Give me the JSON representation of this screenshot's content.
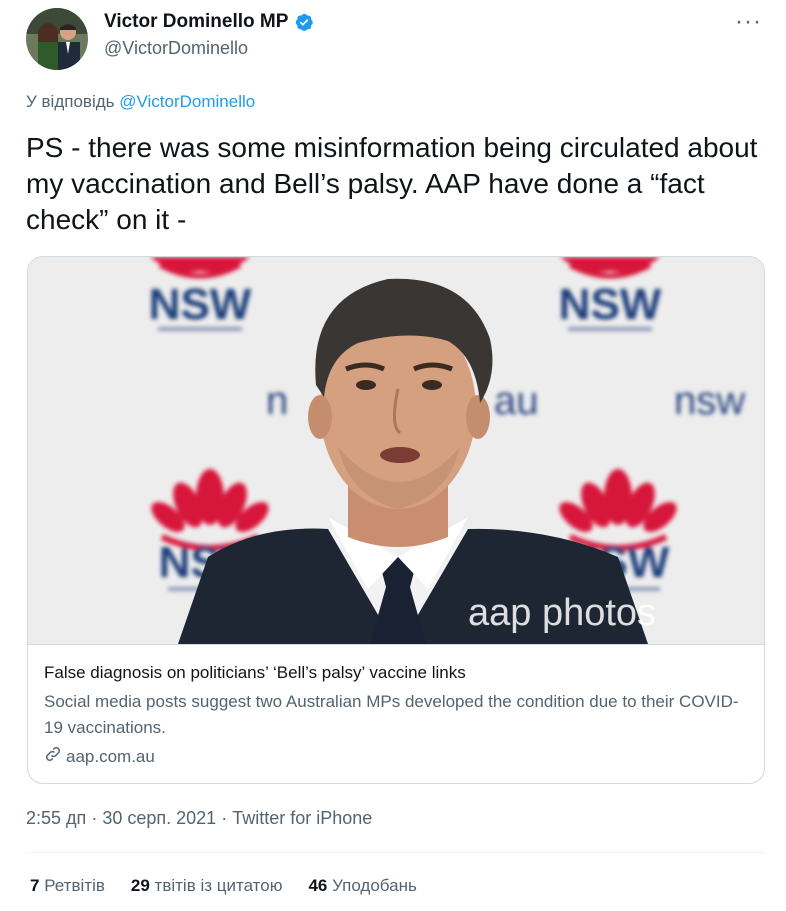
{
  "author": {
    "display_name": "Victor Dominello MP",
    "handle": "@VictorDominello",
    "verified": true,
    "avatar": "profile-photo"
  },
  "more_icon": "more-horizontal-icon",
  "reply": {
    "prefix": "У відповідь",
    "mention": "@VictorDominello"
  },
  "tweet_text": "PS - there was some misinformation being circulated about my vaccination and Bell’s palsy. AAP have done a “fact check” on it -",
  "card": {
    "image_watermark": "aap photos",
    "backdrop_logo_text": "NSW",
    "backdrop_web_text": "nsw.gov.au",
    "title": "False diagnosis on politicians’ ‘Bell’s palsy’ vaccine links",
    "description": "Social media posts suggest two Australian MPs developed the condition due to their COVID-19 vaccinations.",
    "domain": "aap.com.au",
    "link_icon": "link-icon"
  },
  "meta": {
    "time": "2:55 дп",
    "separator": "·",
    "date": "30 серп. 2021",
    "source": "Twitter for iPhone"
  },
  "stats": {
    "retweets_count": "7",
    "retweets_label": "Ретвітів",
    "quotes_count": "29",
    "quotes_label": "твітів із цитатою",
    "likes_count": "46",
    "likes_label": "Уподобань"
  },
  "colors": {
    "accent": "#1d9bf0",
    "secondary_text": "#536471",
    "nsw_red": "#d7153a",
    "nsw_blue": "#002664"
  }
}
